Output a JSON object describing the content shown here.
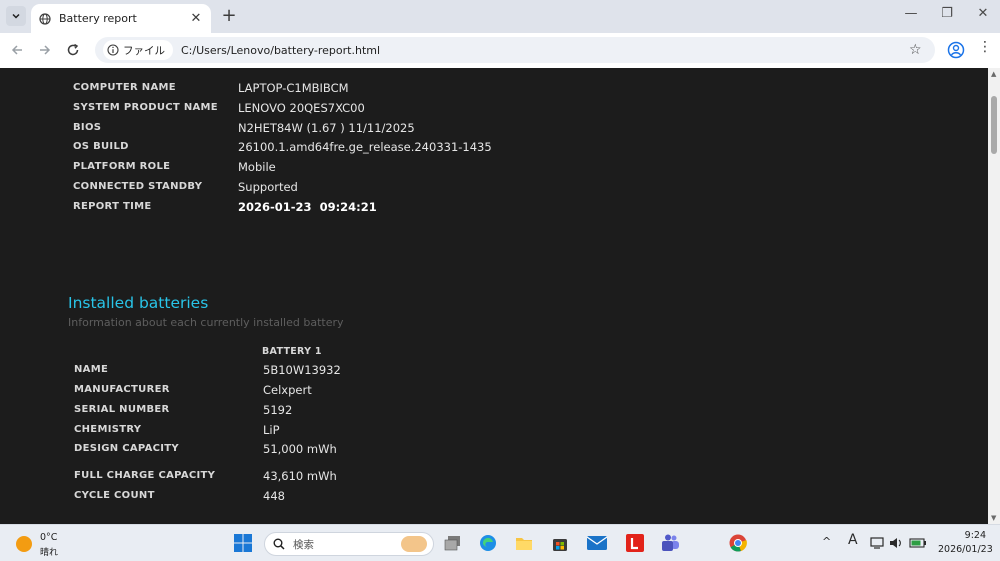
{
  "browser": {
    "tab_title": "Battery report",
    "address_chip": "ファイル",
    "url": "C:/Users/Lenovo/battery-report.html"
  },
  "system_info": [
    {
      "label": "COMPUTER NAME",
      "value": "LAPTOP-C1MBIBCM"
    },
    {
      "label": "SYSTEM PRODUCT NAME",
      "value": "LENOVO 20QES7XC00"
    },
    {
      "label": "BIOS",
      "value": "N2HET84W (1.67 ) 11/11/2025"
    },
    {
      "label": "OS BUILD",
      "value": "26100.1.amd64fre.ge_release.240331-1435"
    },
    {
      "label": "PLATFORM ROLE",
      "value": "Mobile"
    },
    {
      "label": "CONNECTED STANDBY",
      "value": "Supported"
    },
    {
      "label": "REPORT TIME",
      "value": "2026-01-23  09:24:21"
    }
  ],
  "installed_batteries": {
    "title": "Installed batteries",
    "subtitle": "Information about each currently installed battery",
    "column_header": "BATTERY 1",
    "rows": [
      {
        "label": "NAME",
        "value": "5B10W13932"
      },
      {
        "label": "MANUFACTURER",
        "value": "Celxpert"
      },
      {
        "label": "SERIAL NUMBER",
        "value": "5192"
      },
      {
        "label": "CHEMISTRY",
        "value": "LiP"
      },
      {
        "label": "DESIGN CAPACITY",
        "value": "51,000 mWh"
      },
      {
        "label": "FULL CHARGE CAPACITY",
        "value": "43,610 mWh"
      },
      {
        "label": "CYCLE COUNT",
        "value": "448"
      }
    ]
  },
  "taskbar": {
    "temperature": "0°C",
    "weather": "晴れ",
    "search_placeholder": "検索",
    "clock_time": "9:24",
    "clock_date": "2026/01/23",
    "ime_indicator": "A"
  }
}
